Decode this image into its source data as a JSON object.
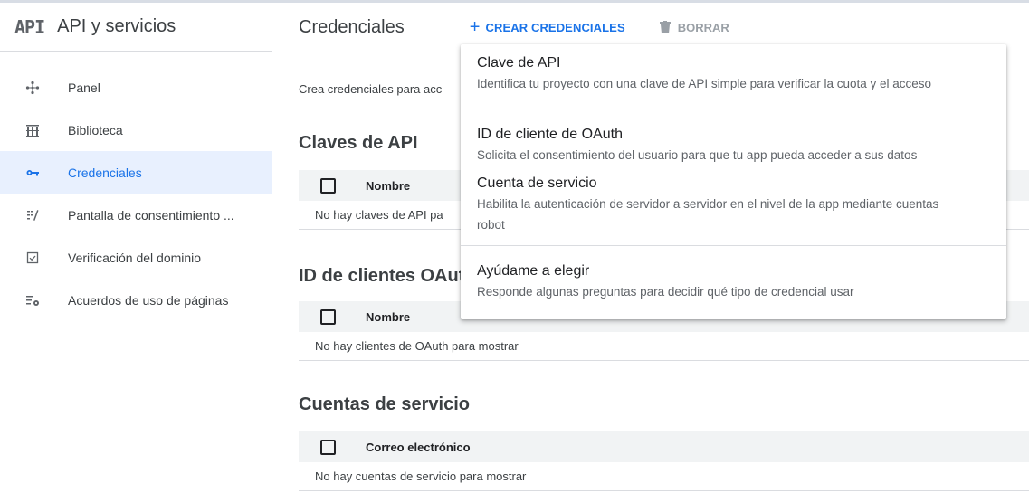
{
  "sidebar": {
    "logo": "API",
    "title": "API y servicios",
    "items": [
      {
        "label": "Panel",
        "icon": "panel-icon",
        "active": false
      },
      {
        "label": "Biblioteca",
        "icon": "library-icon",
        "active": false
      },
      {
        "label": "Credenciales",
        "icon": "key-icon",
        "active": true
      },
      {
        "label": "Pantalla de consentimiento ...",
        "icon": "consent-screen-icon",
        "active": false
      },
      {
        "label": "Verificación del dominio",
        "icon": "domain-verification-icon",
        "active": false
      },
      {
        "label": "Acuerdos de uso de páginas",
        "icon": "page-agreements-icon",
        "active": false
      }
    ]
  },
  "header": {
    "title": "Credenciales",
    "create_label": "CREAR CREDENCIALES",
    "delete_label": "BORRAR"
  },
  "main": {
    "intro": "Crea credenciales para acc",
    "sections": [
      {
        "title": "Claves de API",
        "column": "Nombre",
        "empty": "No hay claves de API pa"
      },
      {
        "title": "ID de clientes OAut",
        "column": "Nombre",
        "empty": "No hay clientes de OAuth para mostrar"
      },
      {
        "title": "Cuentas de servicio",
        "column": "Correo electrónico",
        "empty": "No hay cuentas de servicio para mostrar"
      }
    ]
  },
  "menu": {
    "items": [
      {
        "title": "Clave de API",
        "desc": "Identifica tu proyecto con una clave de API simple para verificar la cuota y el acceso"
      },
      {
        "title": "ID de cliente de OAuth",
        "desc": "Solicita el consentimiento del usuario para que tu app pueda acceder a sus datos"
      },
      {
        "title": "Cuenta de servicio",
        "desc": "Habilita la autenticación de servidor a servidor en el nivel de la app mediante cuentas robot"
      },
      {
        "title": "Ayúdame a elegir",
        "desc": "Responde algunas preguntas para decidir qué tipo de credencial usar"
      }
    ]
  },
  "colors": {
    "accent": "#1a73e8",
    "active_bg": "#e8f0fe",
    "table_header_bg": "#f1f3f4"
  }
}
